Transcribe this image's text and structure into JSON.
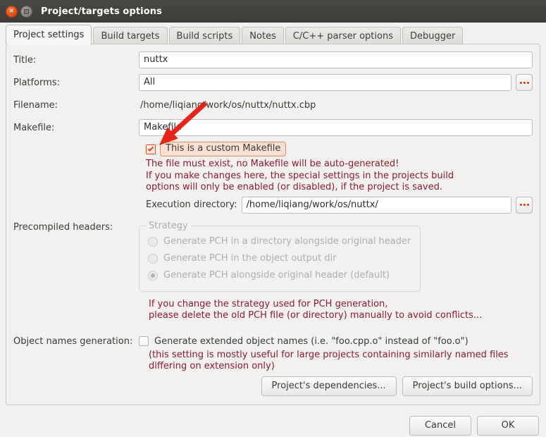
{
  "window": {
    "title": "Project/targets options",
    "close_icon": "close-icon",
    "maximize_icon": "maximize-icon"
  },
  "tabs": [
    {
      "label": "Project settings",
      "active": true
    },
    {
      "label": "Build targets",
      "active": false
    },
    {
      "label": "Build scripts",
      "active": false
    },
    {
      "label": "Notes",
      "active": false
    },
    {
      "label": "C/C++ parser options",
      "active": false
    },
    {
      "label": "Debugger",
      "active": false
    }
  ],
  "form": {
    "title_label": "Title:",
    "title_value": "nuttx",
    "platforms_label": "Platforms:",
    "platforms_value": "All",
    "platforms_browse": "...",
    "filename_label": "Filename:",
    "filename_value": "/home/liqiang/work/os/nuttx/nuttx.cbp",
    "makefile_label": "Makefile:",
    "makefile_value": "Makefile",
    "custom_makefile_label": "This is a custom Makefile",
    "custom_makefile_checked": true,
    "warning_line1": "The file must exist, no Makefile will be auto-generated!",
    "warning_line2": "If you make changes here, the special settings in the projects build",
    "warning_line3": "options will only be enabled (or disabled), if the project is saved.",
    "exec_dir_label": "Execution directory:",
    "exec_dir_value": "/home/liqiang/work/os/nuttx/",
    "exec_dir_browse": "..."
  },
  "pch": {
    "label": "Precompiled headers:",
    "group_title": "Strategy",
    "options": [
      {
        "label": "Generate PCH in a directory alongside original header",
        "selected": false
      },
      {
        "label": "Generate PCH in the object output dir",
        "selected": false
      },
      {
        "label": "Generate PCH alongside original header (default)",
        "selected": true
      }
    ],
    "warning_line1": "If you change the strategy used for PCH generation,",
    "warning_line2": "please delete the old PCH file (or directory) manually to avoid conflicts..."
  },
  "objects": {
    "label": "Object names generation:",
    "checkbox_label": "Generate extended object names (i.e. \"foo.cpp.o\" instead of \"foo.o\")",
    "checkbox_checked": false,
    "note_line1": "(this setting is mostly useful for large projects containing similarly named files",
    "note_line2": "differing on extension only)"
  },
  "panel_buttons": {
    "dependencies": "Project's dependencies...",
    "build_options": "Project's build options..."
  },
  "dialog_buttons": {
    "cancel": "Cancel",
    "ok": "OK"
  },
  "annotation": {
    "arrow_color": "#e8241a",
    "arrow_name": "red-pointer-arrow"
  },
  "colors": {
    "accent": "#dd4814",
    "warning_text": "#8e1b2d",
    "titlebar": "#3c3b37",
    "background": "#f2f1f0"
  }
}
